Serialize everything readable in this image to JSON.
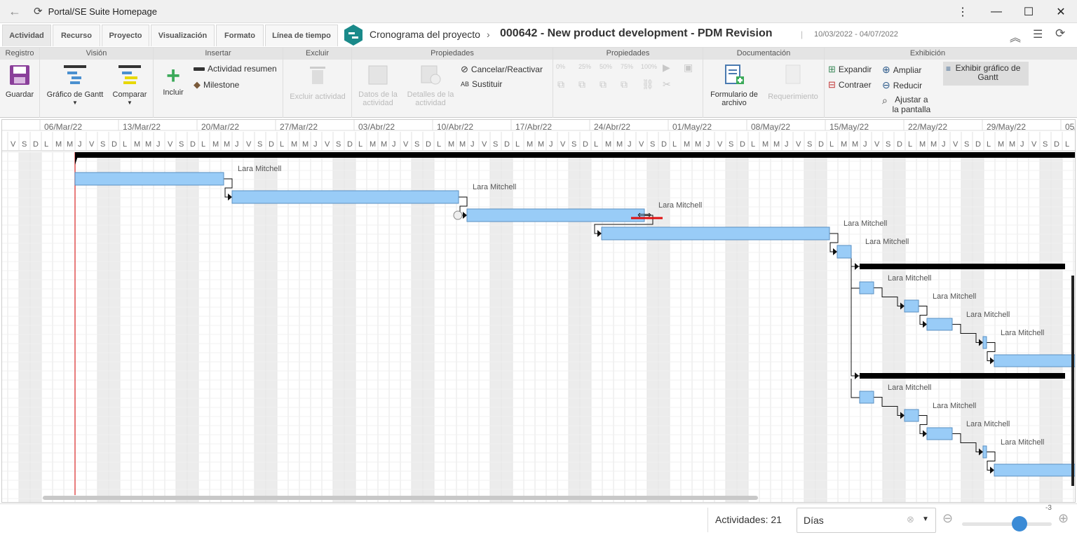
{
  "window": {
    "title": "Portal/SE Suite Homepage"
  },
  "tabs": [
    "Actividad",
    "Recurso",
    "Proyecto",
    "Visualización",
    "Formato",
    "Línea de tiempo"
  ],
  "breadcrumb": {
    "section": "Cronograma del proyecto",
    "project": "000642 - New product development - PDM Revision",
    "dates": "10/03/2022 - 04/07/2022"
  },
  "groups": [
    "Registro",
    "Visión",
    "Insertar",
    "Excluir",
    "Propiedades",
    "Propiedades",
    "Documentación",
    "Exhibición"
  ],
  "buttons": {
    "save": "Guardar",
    "gantt": "Gráfico de Gantt",
    "compare": "Comparar",
    "include": "Incluir",
    "summary": "Actividad resumen",
    "milestone": "Milestone",
    "delete": "Excluir actividad",
    "data": "Datos de la actividad",
    "details": "Detalles de la actividad",
    "cancel": "Cancelar/Reactivar",
    "replace": "Sustituir",
    "form": "Formulario de archivo",
    "requirement": "Requerimiento",
    "expand": "Expandir",
    "collapse": "Contraer",
    "zoom_in": "Ampliar",
    "zoom_out": "Reducir",
    "fit": "Ajustar a la pantalla",
    "show_gantt": "Exhibir gráfico de Gantt"
  },
  "timeline": {
    "weeks": [
      "06/Mar/22",
      "13/Mar/22",
      "20/Mar/22",
      "27/Mar/22",
      "03/Abr/22",
      "10/Abr/22",
      "17/Abr/22",
      "24/Abr/22",
      "01/May/22",
      "08/May/22",
      "15/May/22",
      "22/May/22",
      "29/May/22",
      "05/J"
    ],
    "days": [
      "V",
      "S",
      "D",
      "L",
      "M",
      "M",
      "J"
    ]
  },
  "resource": "Lara Mitchell",
  "footer": {
    "activities": "Actividades: 21",
    "scale": "Días",
    "zoom": "-3"
  },
  "colors": {
    "bar": "#99ccf7",
    "bar_border": "#5a8fc2",
    "summary": "#000000",
    "today": "#e05050",
    "accent": "#1a8a8a"
  }
}
